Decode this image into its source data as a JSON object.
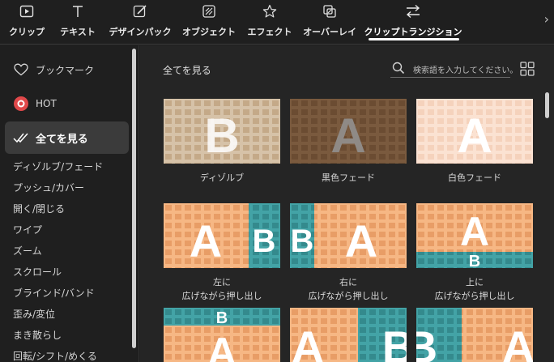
{
  "tabs": [
    {
      "label": "クリップ",
      "icon": "clip-icon"
    },
    {
      "label": "テキスト",
      "icon": "text-icon"
    },
    {
      "label": "デザインパック",
      "icon": "design-pack-icon"
    },
    {
      "label": "オブジェクト",
      "icon": "object-icon"
    },
    {
      "label": "エフェクト",
      "icon": "effect-star-icon"
    },
    {
      "label": "オーバーレイ",
      "icon": "overlay-icon"
    },
    {
      "label": "クリップトランジション",
      "icon": "transition-arrows-icon",
      "active": true
    }
  ],
  "sidebar": {
    "bookmark": "ブックマーク",
    "hot": "HOT",
    "all": "全てを見る",
    "categories": [
      "ディゾルブ/フェード",
      "プッシュ/カバー",
      "開く/閉じる",
      "ワイプ",
      "ズーム",
      "スクロール",
      "ブラインド/バンド",
      "歪み/変位",
      "まき散らし",
      "回転/シフト/めくる"
    ]
  },
  "main": {
    "title": "全てを見る",
    "search_placeholder": "検索語を入力してください。",
    "items": [
      {
        "label": "ディゾルブ"
      },
      {
        "label": "黒色フェード"
      },
      {
        "label": "白色フェード"
      },
      {
        "label": "左に\n広げながら押し出し"
      },
      {
        "label": "右に\n広げながら押し出し"
      },
      {
        "label": "上に\n広げながら押し出し"
      }
    ]
  },
  "colors": {
    "background": "#1f1f1f",
    "panel": "#252525",
    "active_item": "#3b3b3b",
    "thumb_orange": "#f6b784",
    "thumb_teal": "#43a3a6",
    "hot_red": "#e0484a"
  }
}
